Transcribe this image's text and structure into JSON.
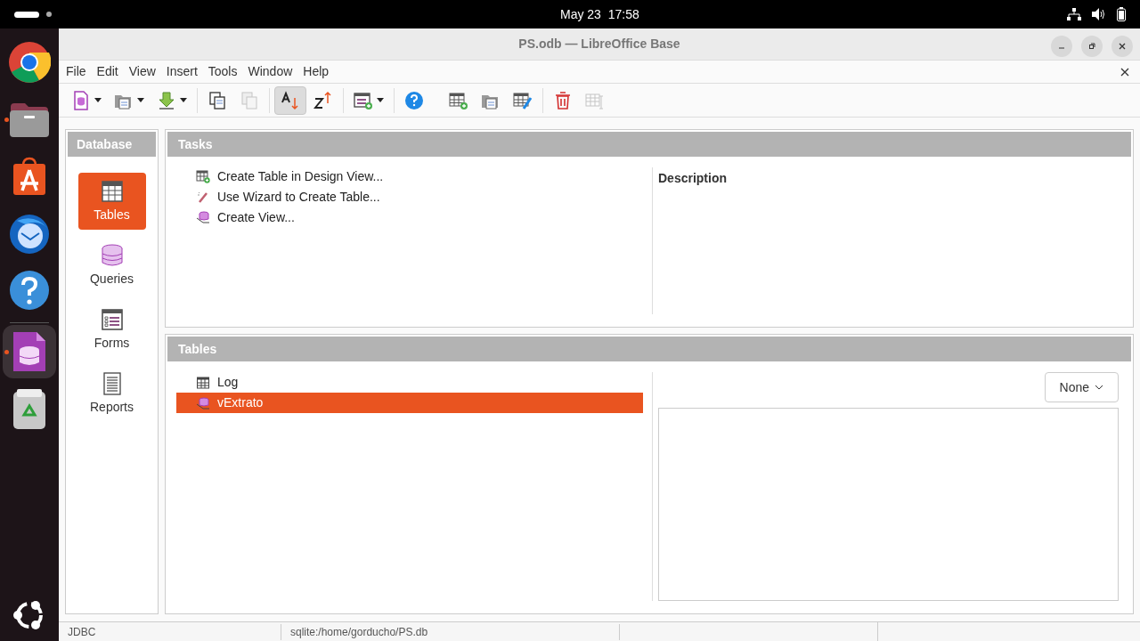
{
  "topbar": {
    "clock": "May 23  17:58"
  },
  "dock": [
    {
      "kind": "chrome",
      "running": false,
      "selected": false
    },
    {
      "kind": "files",
      "running": true,
      "selected": false
    },
    {
      "kind": "store",
      "running": false,
      "selected": false
    },
    {
      "kind": "mail",
      "running": false,
      "selected": false
    },
    {
      "kind": "help",
      "running": false,
      "selected": false
    },
    {
      "kind": "base",
      "running": true,
      "selected": true
    },
    {
      "kind": "trash",
      "running": false,
      "selected": false
    }
  ],
  "window": {
    "title": "PS.odb — LibreOffice Base"
  },
  "menu": [
    "File",
    "Edit",
    "View",
    "Insert",
    "Tools",
    "Window",
    "Help"
  ],
  "toolbar": [
    {
      "kind": "new",
      "dropdown": true,
      "pressed": false,
      "disabled": false
    },
    {
      "kind": "open",
      "dropdown": true,
      "pressed": false,
      "disabled": false
    },
    {
      "kind": "save",
      "dropdown": true,
      "pressed": false,
      "disabled": false
    },
    {
      "kind": "sep"
    },
    {
      "kind": "copy",
      "dropdown": false,
      "pressed": false,
      "disabled": false
    },
    {
      "kind": "paste",
      "dropdown": false,
      "pressed": false,
      "disabled": true
    },
    {
      "kind": "sep"
    },
    {
      "kind": "sort-asc",
      "dropdown": false,
      "pressed": true,
      "disabled": false
    },
    {
      "kind": "sort-desc",
      "dropdown": false,
      "pressed": false,
      "disabled": false
    },
    {
      "kind": "sep"
    },
    {
      "kind": "form",
      "dropdown": true,
      "pressed": false,
      "disabled": false
    },
    {
      "kind": "sep"
    },
    {
      "kind": "help",
      "dropdown": false,
      "pressed": false,
      "disabled": false
    },
    {
      "kind": "sep-none"
    },
    {
      "kind": "table-new",
      "dropdown": false,
      "pressed": false,
      "disabled": false
    },
    {
      "kind": "open",
      "dropdown": false,
      "pressed": false,
      "disabled": false
    },
    {
      "kind": "table-edit",
      "dropdown": false,
      "pressed": false,
      "disabled": false
    },
    {
      "kind": "sep"
    },
    {
      "kind": "delete",
      "dropdown": false,
      "pressed": false,
      "disabled": false
    },
    {
      "kind": "table-rename",
      "dropdown": false,
      "pressed": false,
      "disabled": true
    }
  ],
  "sidebar": {
    "title": "Database",
    "items": [
      {
        "label": "Tables",
        "kind": "tables",
        "selected": true
      },
      {
        "label": "Queries",
        "kind": "queries",
        "selected": false
      },
      {
        "label": "Forms",
        "kind": "forms",
        "selected": false
      },
      {
        "label": "Reports",
        "kind": "reports",
        "selected": false
      }
    ]
  },
  "tasks": {
    "title": "Tasks",
    "items": [
      {
        "label": "Create Table in Design View...",
        "kind": "design"
      },
      {
        "label": "Use Wizard to Create Table...",
        "kind": "wizard"
      },
      {
        "label": "Create View...",
        "kind": "view"
      }
    ],
    "description_label": "Description"
  },
  "tables": {
    "title": "Tables",
    "items": [
      {
        "label": "Log",
        "kind": "table",
        "selected": false
      },
      {
        "label": "vExtrato",
        "kind": "view",
        "selected": true
      }
    ],
    "preview_mode": "None"
  },
  "status_bar": [
    "JDBC",
    "sqlite:/home/gorducho/PS.db"
  ]
}
